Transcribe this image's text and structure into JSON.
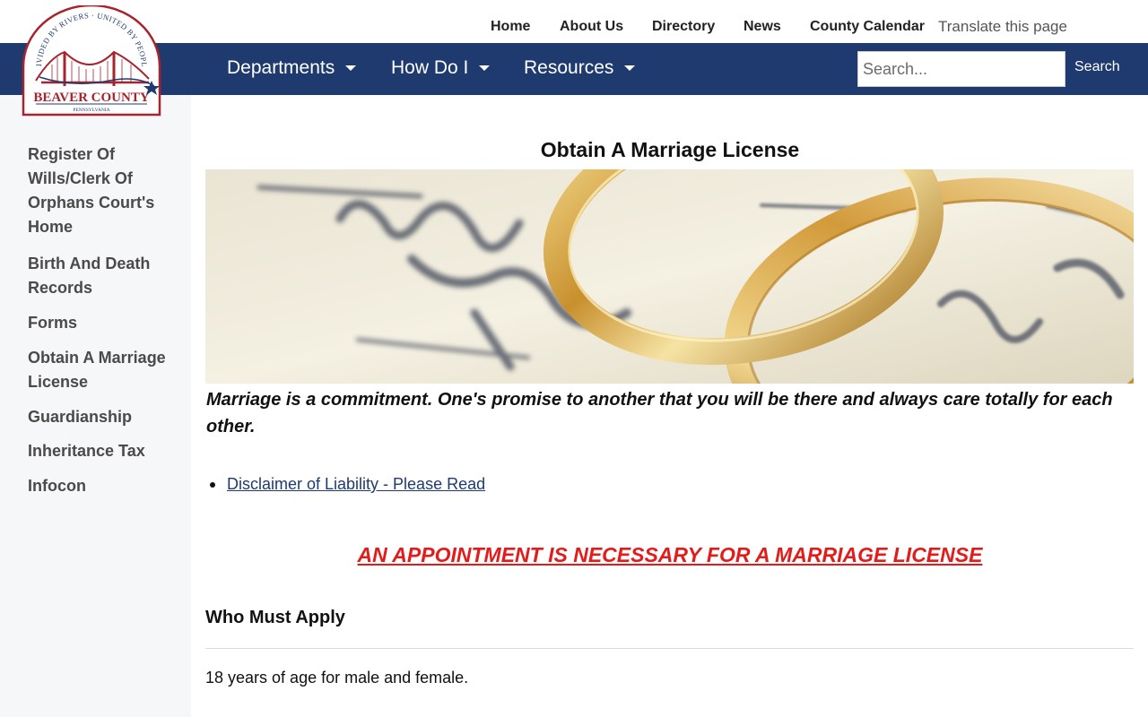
{
  "top_links": [
    {
      "label": "Home"
    },
    {
      "label": "About Us"
    },
    {
      "label": "Directory"
    },
    {
      "label": "News"
    },
    {
      "label": "County Calendar"
    }
  ],
  "translate_label": "Translate this page",
  "logo": {
    "motto": "DIVIDED BY RIVERS · UNITED BY PEOPLE",
    "name": "BEAVER COUNTY",
    "state": "PENNSYLVANIA"
  },
  "nav": {
    "items": [
      {
        "label": "Departments"
      },
      {
        "label": "How Do I"
      },
      {
        "label": "Resources"
      }
    ],
    "search_placeholder": "Search...",
    "search_button": "Search"
  },
  "sidebar": {
    "items": [
      {
        "label": "Register Of Wills/Clerk Of Orphans Court's Home"
      },
      {
        "label": "Birth And Death Records"
      },
      {
        "label": "Forms"
      },
      {
        "label": "Obtain A Marriage License"
      },
      {
        "label": "Guardianship"
      },
      {
        "label": "Inheritance Tax"
      },
      {
        "label": "Infocon"
      }
    ]
  },
  "main": {
    "title": "Obtain A Marriage License",
    "hero_alt": "wedding-rings-photo",
    "quote": "Marriage is a commitment. One's promise to another that you will be there and always care totally for each other.",
    "disclaimer_link": "Disclaimer of Liability - Please Read",
    "appointment_notice": "AN APPOINTMENT IS NECESSARY FOR A MARRIAGE LICENSE",
    "who_heading": "Who Must Apply",
    "age_requirement": "18 years of age for male and female."
  },
  "colors": {
    "navbar": "#1f3a6e",
    "sidebar_bg": "#f6f7f8",
    "alert_red": "#e31b1b",
    "logo_red": "#a8232b"
  }
}
